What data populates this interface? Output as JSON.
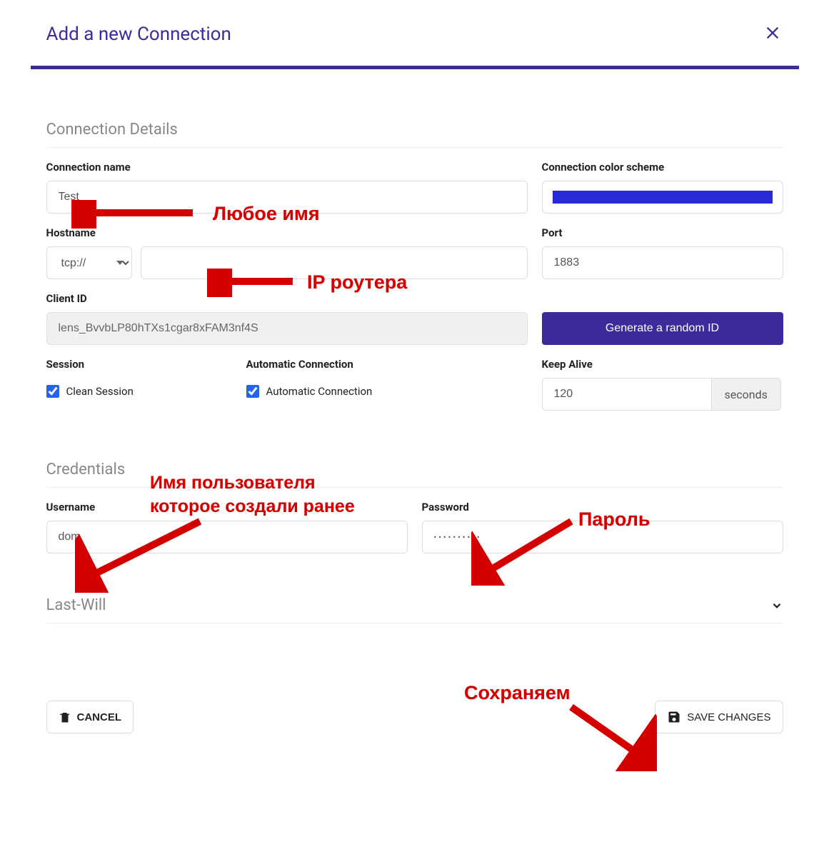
{
  "dialog": {
    "title": "Add a new Connection"
  },
  "sections": {
    "connection_details": "Connection Details",
    "credentials": "Credentials",
    "lastwill": "Last-Will"
  },
  "fields": {
    "connection_name": {
      "label": "Connection name",
      "value": "Test"
    },
    "color_scheme": {
      "label": "Connection color scheme",
      "color": "#2b2bd6"
    },
    "hostname": {
      "label": "Hostname",
      "protocol": "tcp://",
      "value": ""
    },
    "port": {
      "label": "Port",
      "value": "1883"
    },
    "client_id": {
      "label": "Client ID",
      "value": "lens_BvvbLP80hTXs1cgar8xFAM3nf4S"
    },
    "session": {
      "label": "Session",
      "checkbox_label": "Clean Session"
    },
    "auto_conn": {
      "label": "Automatic Connection",
      "checkbox_label": "Automatic Connection"
    },
    "keep_alive": {
      "label": "Keep Alive",
      "value": "120",
      "unit": "seconds"
    },
    "username": {
      "label": "Username",
      "value": "dom"
    },
    "password": {
      "label": "Password",
      "value": "••••••••••"
    }
  },
  "buttons": {
    "generate_id": "Generate a random ID",
    "cancel": "CANCEL",
    "save": "SAVE CHANGES"
  },
  "annotations": {
    "name_hint": "Любое имя",
    "ip_hint": "IP роутера",
    "username_hint": "Имя пользователя\nкоторое создали ранее",
    "password_hint": "Пароль",
    "save_hint": "Сохраняем"
  }
}
